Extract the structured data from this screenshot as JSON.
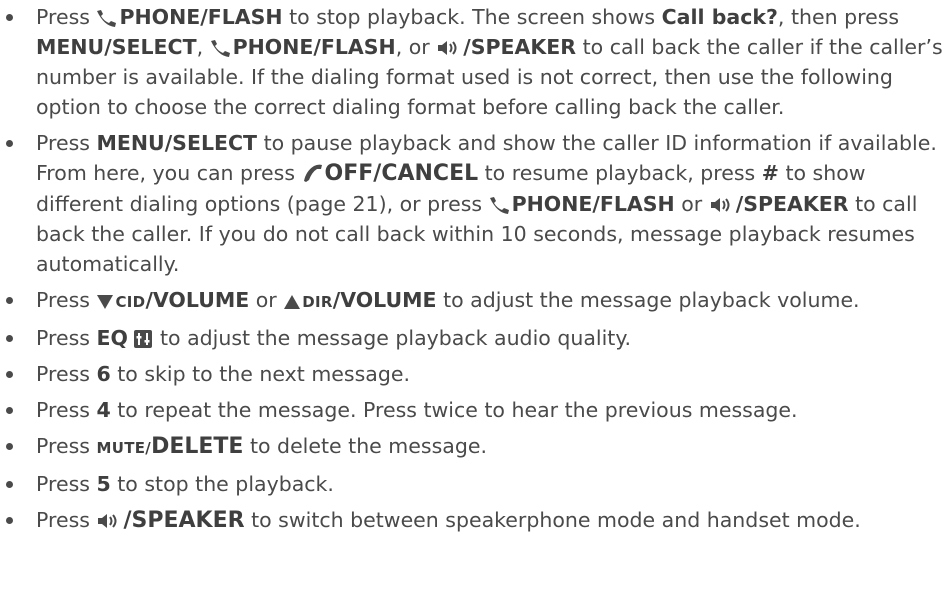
{
  "items": [
    {
      "parts": {
        "t0": "Press ",
        "k0": "PHONE/FLASH",
        "t1": " to stop playback. The screen shows ",
        "k1": "Call back?",
        "t2": ", then press ",
        "k2": "MENU/SELECT",
        "t3": ", ",
        "k3": "PHONE/FLASH",
        "t4": ", or ",
        "k4": "/SPEAKER",
        "t5": " to call back the caller if the caller’s number is available. If the dialing format used is not correct, then use the following option to choose the correct dialing format before calling back the caller."
      }
    },
    {
      "parts": {
        "t0": "Press ",
        "k0": "MENU/SELECT",
        "t1": " to pause playback and show the caller ID information if available. From here, you can press ",
        "k1": "OFF/CANCEL",
        "t2": " to resume playback, press ",
        "k2": "#",
        "t3": " to show different dialing options (page 21), or press ",
        "k3": "PHONE/FLASH",
        "t4": " or ",
        "k4": "/SPEAKER",
        "t5": " to call back the caller. If you do not call back within 10 seconds, message playback resumes automatically."
      }
    },
    {
      "parts": {
        "t0": "Press ",
        "s0": "CID",
        "k0": "/VOLUME",
        "t1": " or ",
        "s1": "DIR",
        "k1": "/VOLUME",
        "t2": " to adjust the message playback volume."
      }
    },
    {
      "parts": {
        "t0": "Press ",
        "k0": "EQ",
        "t1": " to adjust the message playback audio quality."
      }
    },
    {
      "parts": {
        "t0": "Press ",
        "k0": "6",
        "t1": " to skip to the next message."
      }
    },
    {
      "parts": {
        "t0": "Press ",
        "k0": "4",
        "t1": " to repeat the message. Press twice to hear the previous message."
      }
    },
    {
      "parts": {
        "t0": "Press ",
        "s0": "MUTE/",
        "k0": "DELETE",
        "t1": " to delete the message."
      }
    },
    {
      "parts": {
        "t0": "Press ",
        "k0": "5",
        "t1": " to stop the playback."
      }
    },
    {
      "parts": {
        "t0": "Press ",
        "k0": "/SPEAKER",
        "t1": " to switch between speakerphone mode and handset mode."
      }
    }
  ],
  "icons": {
    "phone": "phone-handset-icon",
    "speaker": "speaker-icon",
    "off": "off-cancel-icon",
    "down": "volume-down-triangle-icon",
    "up": "volume-up-triangle-icon",
    "eq": "equalizer-icon"
  },
  "colors": {
    "text": "#4a4a4a",
    "bold": "#3f3f3f"
  }
}
